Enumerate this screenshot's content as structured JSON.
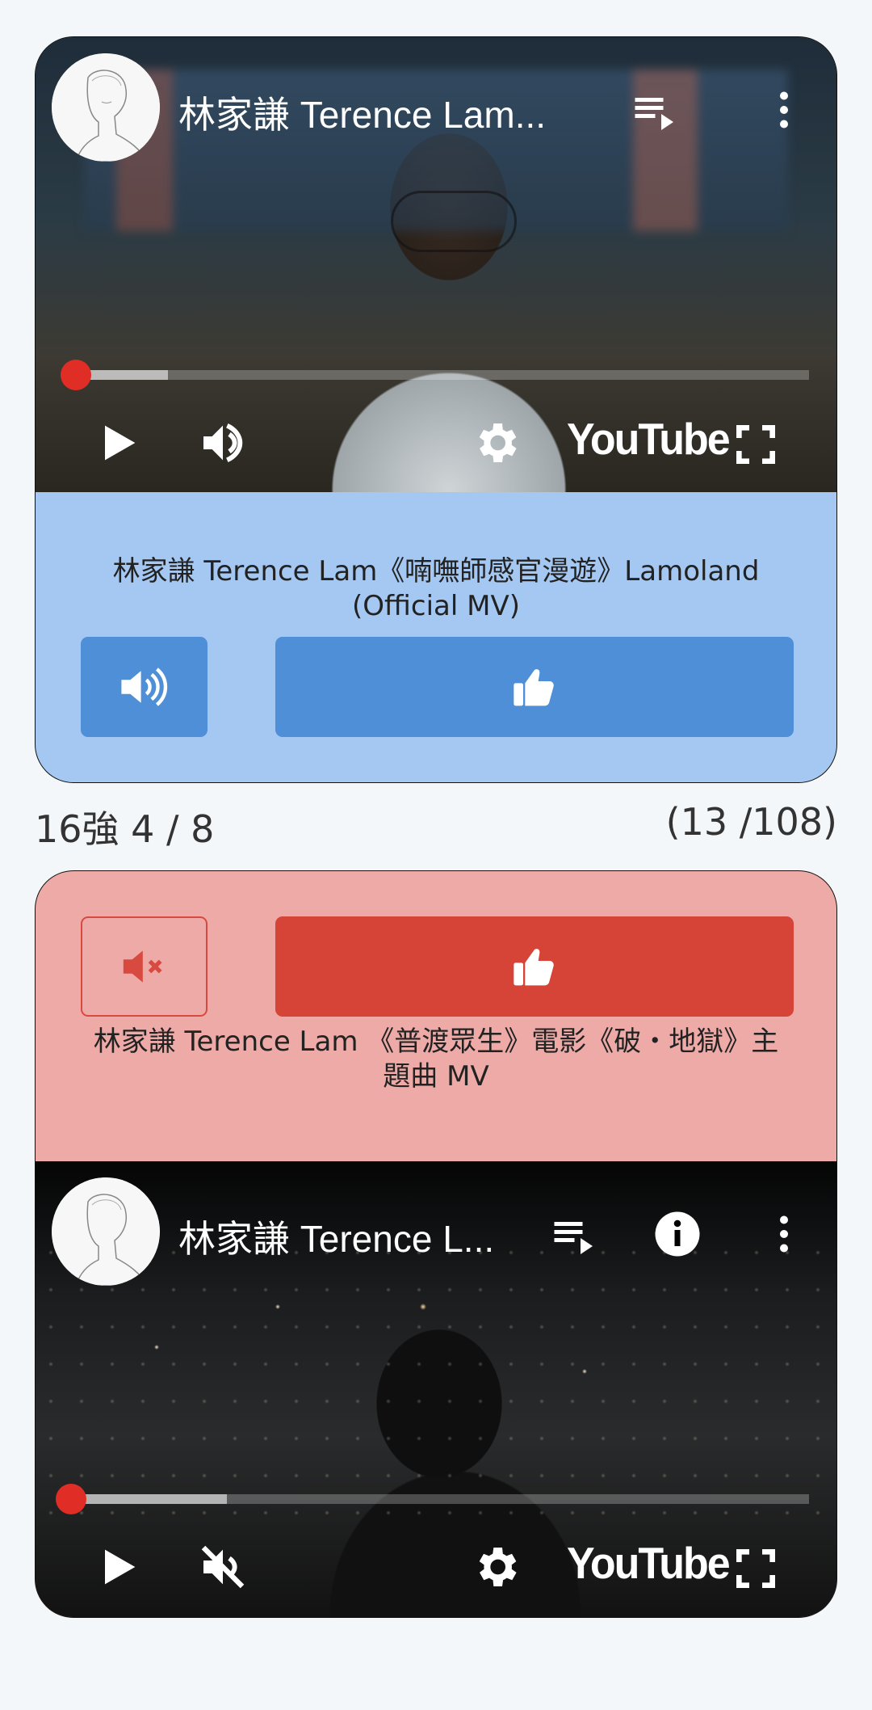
{
  "round": "16強 4 / 8",
  "counter": "(13 /108)",
  "top_video": {
    "channel_title": "林家謙 Terence Lam...",
    "logo": "YouTube",
    "song_title": "林家謙 Terence Lam《喃嘸師感官漫遊》Lamoland (Official MV)",
    "progress_buffered_fraction": 0.13,
    "muted": false,
    "accent": "#4f8fd7",
    "panel_color": "#a5c8f3"
  },
  "bottom_video": {
    "channel_title": "林家謙 Terence L...",
    "logo": "YouTube",
    "song_title": "林家謙 Terence Lam 《普渡眾生》電影《破・地獄》主題曲 MV",
    "progress_buffered_fraction": 0.21,
    "muted": true,
    "accent": "#d64337",
    "panel_color": "#edaaa7"
  },
  "icons": {
    "playlist": "playlist-icon",
    "more": "more-vert-icon",
    "info": "info-icon",
    "play": "play-icon",
    "volume": "volume-icon",
    "muted": "volume-mute-icon",
    "settings": "gear-icon",
    "fullscreen": "fullscreen-icon",
    "thumbs_up": "thumbs-up-icon"
  }
}
